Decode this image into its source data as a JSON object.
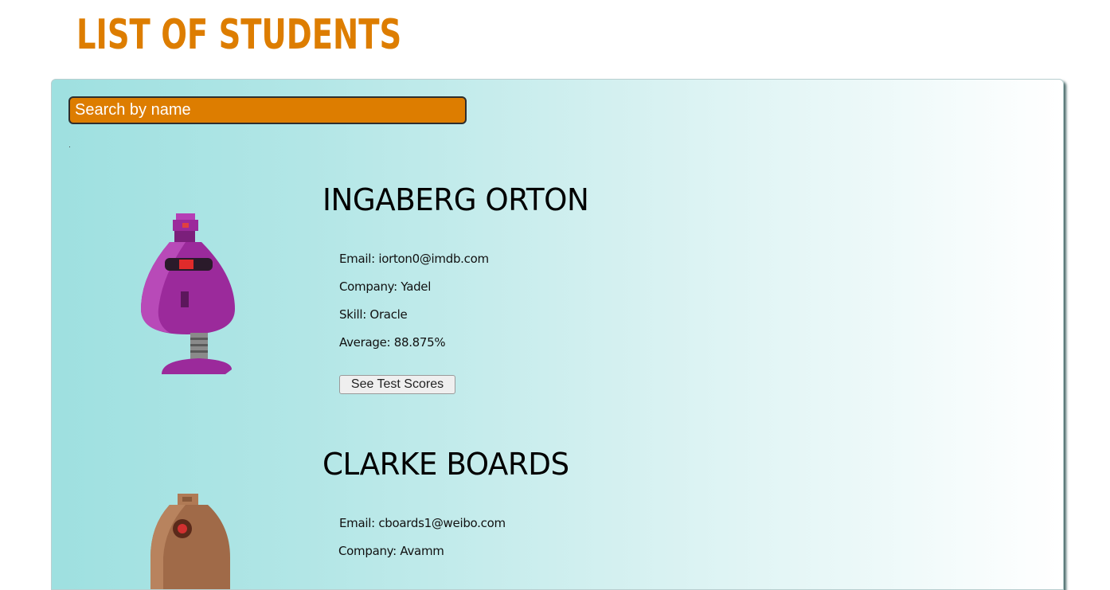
{
  "header": {
    "title": "LIST OF STUDENTS"
  },
  "search": {
    "placeholder": "Search by name"
  },
  "students": [
    {
      "name": "INGABERG ORTON",
      "email": "Email: iorton0@imdb.com",
      "company": "Company: Yadel",
      "skill": "Skill: Oracle",
      "average": "Average: 88.875%",
      "button_label": "See Test Scores",
      "avatar_icon": "purple-robot-icon",
      "avatar_color": "#9b2a9b"
    },
    {
      "name": "CLARKE BOARDS",
      "email": "Email: cboards1@weibo.com",
      "company": "Company: Avamm",
      "avatar_icon": "brown-robot-icon",
      "avatar_color": "#a06a48"
    }
  ],
  "colors": {
    "accent": "#dd7d00",
    "card_gradient_start": "#9ee0e0",
    "card_gradient_end": "#ffffff"
  }
}
